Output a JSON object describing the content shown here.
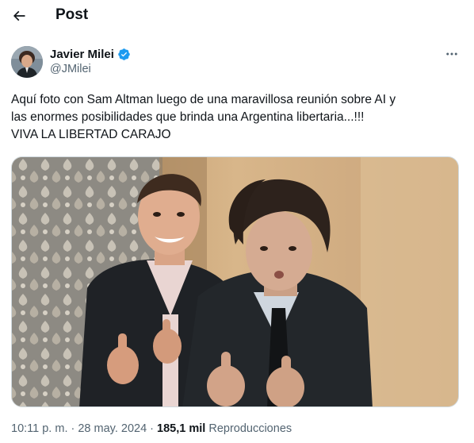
{
  "header": {
    "title": "Post",
    "back_icon": "arrow-left-icon"
  },
  "author": {
    "name": "Javier Milei",
    "handle": "@JMilei",
    "verified": true,
    "verified_color": "#1d9bf0"
  },
  "tweet": {
    "lines": [
      "Aquí foto con Sam Altman luego de una maravillosa reunión sobre AI y",
      "las enormes posibilidades que brinda una Argentina libertaria...!!!",
      "VIVA LA LIBERTAD CARAJO"
    ]
  },
  "media": {
    "kind": "photo"
  },
  "meta": {
    "time": "10:11 p. m.",
    "separator": " · ",
    "date": "28 may. 2024",
    "views_count": "185,1 mil",
    "views_label": "Reproducciones"
  },
  "colors": {
    "text": "#0f1419",
    "secondary": "#536471",
    "accent": "#1d9bf0",
    "border": "#cfd9de"
  }
}
